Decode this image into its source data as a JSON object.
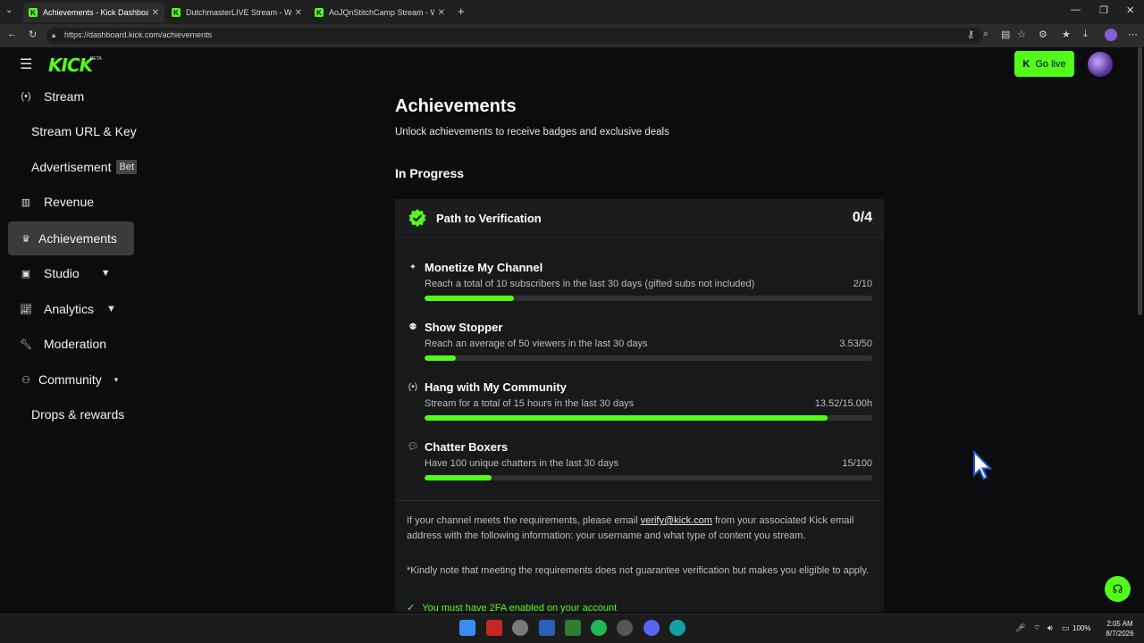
{
  "browser": {
    "tabs": [
      {
        "label": "Achievements - Kick Dashboard",
        "active": true
      },
      {
        "label": "DutchmasterLIVE Stream - Wa",
        "active": false
      },
      {
        "label": "AoJQnStitchCamp Stream - Watch",
        "active": false
      }
    ],
    "url": "https://dashboard.kick.com/achievements"
  },
  "header": {
    "logo": "KICK",
    "logo_beta": "BETA",
    "go_live_label": "Go live"
  },
  "sidebar": {
    "items": [
      {
        "label": "Stream",
        "icon": "broadcast-icon"
      },
      {
        "label": "Stream URL & Key"
      },
      {
        "label": "Advertisement",
        "badge": "Bet"
      },
      {
        "label": "Revenue",
        "icon": "chart-icon"
      },
      {
        "label": "Achievements",
        "icon": "trophy-icon",
        "active": true
      },
      {
        "label": "Studio",
        "icon": "film-icon"
      },
      {
        "label": "Analytics",
        "icon": "analytics-icon"
      },
      {
        "label": "Moderation",
        "icon": "wrench-icon"
      },
      {
        "label": "Community",
        "icon": "people-icon"
      },
      {
        "label": "Drops & rewards"
      }
    ]
  },
  "main": {
    "title": "Achievements",
    "subtitle": "Unlock achievements to receive badges and exclusive deals",
    "section": "In Progress",
    "card": {
      "title": "Path to Verification",
      "count": "0/4",
      "achievements": [
        {
          "title": "Monetize My Channel",
          "desc": "Reach a total of 10 subscribers in the last 30 days (gifted subs not included)",
          "value": "2/10",
          "progress": 0.2,
          "icon": "sparkle-icon"
        },
        {
          "title": "Show Stopper",
          "desc": "Reach an average of 50 viewers in the last 30 days",
          "value": "3.53/50",
          "progress": 0.07,
          "icon": "viewers-icon"
        },
        {
          "title": "Hang with My Community",
          "desc": "Stream for a total of 15 hours in the last 30 days",
          "value": "13.52/15.00h",
          "progress": 0.9,
          "icon": "broadcast-icon"
        },
        {
          "title": "Chatter Boxers",
          "desc": "Have 100 unique chatters in the last 30 days",
          "value": "15/100",
          "progress": 0.15,
          "icon": "chat-icon"
        }
      ],
      "info_prefix": "If your channel meets the requirements, please email ",
      "info_email": "verify@kick.com",
      "info_suffix": " from your associated Kick email address with the following information: your username and what type of content you stream.",
      "note": "*Kindly note that meeting the requirements does not guarantee verification but makes you eligible to apply.",
      "requirement": "You must have 2FA enabled on your account"
    }
  },
  "taskbar": {
    "battery": "100%",
    "time": "2:05 AM",
    "date": "8/7/2026"
  },
  "colors": {
    "accent": "#53fc18",
    "background": "#0b0c0d",
    "card": "#18191b"
  }
}
